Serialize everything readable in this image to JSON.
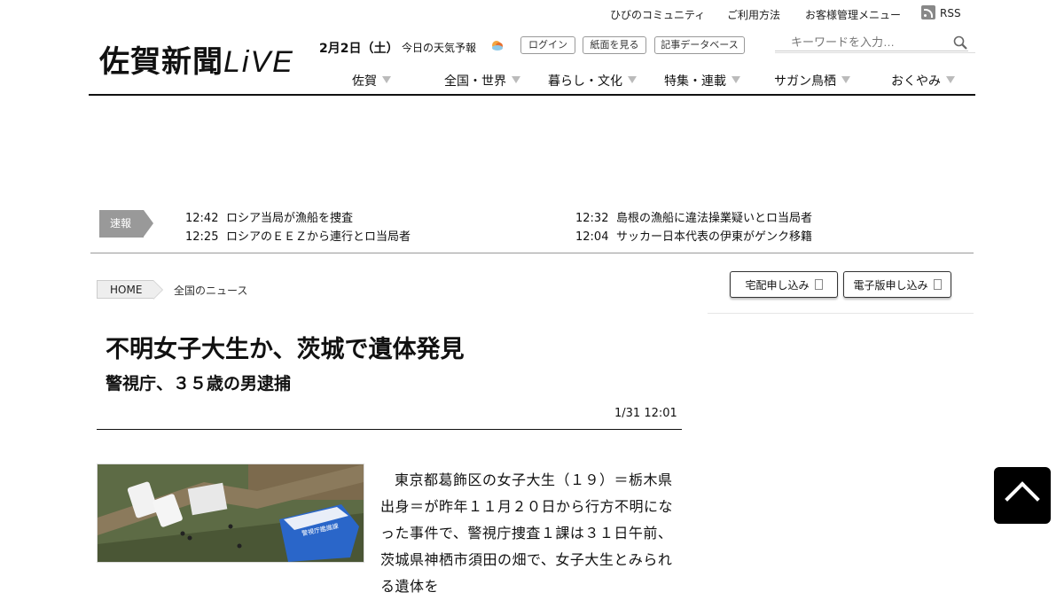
{
  "util_links": {
    "community": "ひびのコミュニティ",
    "usage": "ご利用方法",
    "account": "お客様管理メニュー",
    "rss": "RSS"
  },
  "logo": {
    "kanji": "佐賀新聞",
    "live": "LiVE"
  },
  "header": {
    "date": "2月2日（土）",
    "weather": "今日の天気予報",
    "weather_icon": "weather-icon",
    "login": "ログイン",
    "paper_view": "紙面を見る",
    "archive": "記事データベース"
  },
  "search": {
    "placeholder": "キーワードを入力…"
  },
  "nav": [
    {
      "label": "佐賀"
    },
    {
      "label": "全国・世界"
    },
    {
      "label": "暮らし・文化"
    },
    {
      "label": "特集・連載"
    },
    {
      "label": "サガン鳥栖"
    },
    {
      "label": "おくやみ"
    }
  ],
  "breaking": {
    "label": "速報",
    "items": [
      {
        "time": "12:42",
        "text": "ロシア当局が漁船を捜査"
      },
      {
        "time": "12:32",
        "text": "島根の漁船に違法操業疑いとロ当局者"
      },
      {
        "time": "12:25",
        "text": "ロシアのＥＥＺから連行とロ当局者"
      },
      {
        "time": "12:04",
        "text": "サッカー日本代表の伊東がゲンク移籍"
      }
    ]
  },
  "breadcrumb": {
    "home": "HOME",
    "current": "全国のニュース"
  },
  "subscribe": {
    "delivery": "宅配申し込み",
    "digital": "電子版申し込み"
  },
  "article": {
    "headline": "不明女子大生か、茨城で遺体発見",
    "subhead": "警視庁、３５歳の男逮捕",
    "date": "1/31 12:01",
    "photo_sign": "警視庁鑑識課",
    "body": "東京都葛飾区の女子大生（１９）＝栃木県出身＝が昨年１１月２０日から行方不明になった事件で、警視庁捜査１課は３１日午前、茨城県神栖市須田の畑で、女子大生とみられる遺体を"
  },
  "colors": {
    "accent": "#111111",
    "breaking_label": "#999999",
    "rule": "#111111"
  }
}
